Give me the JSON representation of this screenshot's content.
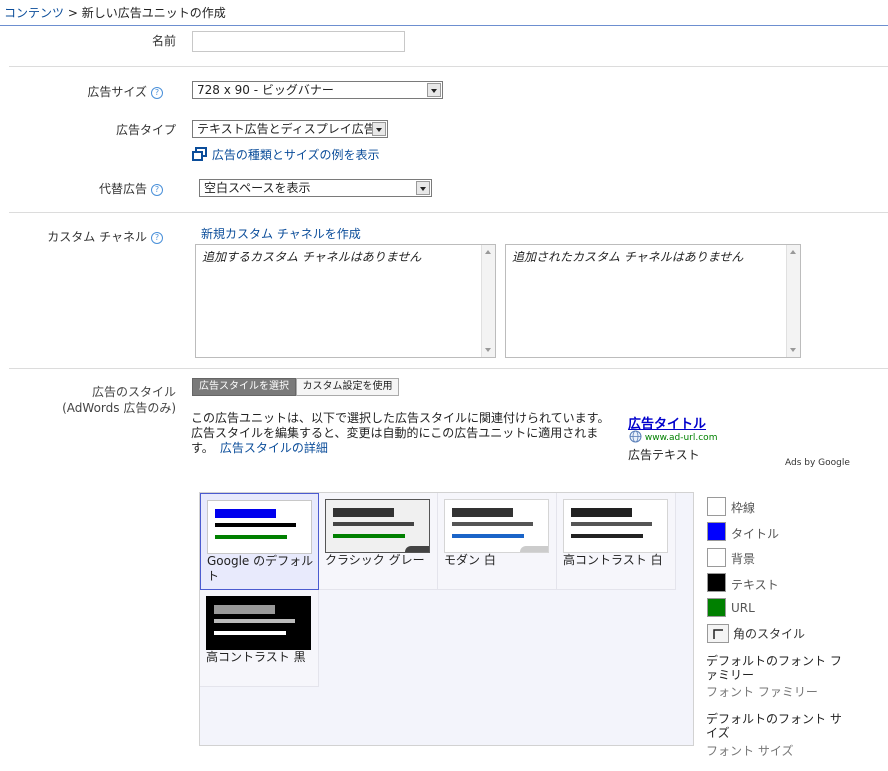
{
  "breadcrumb": {
    "root": "コンテンツ",
    "sep": " > ",
    "current": "新しい広告ユニットの作成"
  },
  "form": {
    "name_label": "名前",
    "name_value": "",
    "size_label": "広告サイズ",
    "size_value": "728 x 90 - ビッグバナー",
    "type_label": "広告タイプ",
    "type_value": "テキスト広告とディスプレイ広告",
    "type_examples_link": "広告の種類とサイズの例を表示",
    "alt_label": "代替広告",
    "alt_value": "空白スペースを表示",
    "help_glyph": "?"
  },
  "channels": {
    "label": "カスタム チャネル",
    "new_link": "新規カスタム チャネルを作成",
    "available_empty": "追加するカスタム チャネルはありません",
    "added_empty": "追加されたカスタム チャネルはありません"
  },
  "style": {
    "label": "広告のスタイル",
    "sublabel": "(AdWords 広告のみ)",
    "tab_select": "広告スタイルを選択",
    "tab_custom": "カスタム設定を使用",
    "desc_1": "この広告ユニットは、以下で選択した広告スタイルに関連付けられています。",
    "desc_2": "広告スタイルを編集すると、変更は自動的にこの広告ユニットに適用されま",
    "desc_3": "す。",
    "desc_link": "広告スタイルの詳細",
    "preview_title": "広告タイトル",
    "preview_url": "www.ad-url.com",
    "preview_text": "広告テキスト",
    "ads_by": "Ads by Google",
    "presets": [
      {
        "name": "Google のデフォルト"
      },
      {
        "name": "クラシック グレー"
      },
      {
        "name": "モダン 白"
      },
      {
        "name": "高コントラスト 白"
      },
      {
        "name": "高コントラスト 黒"
      }
    ],
    "colors": {
      "border_label": "枠線",
      "border": "#ffffff",
      "title_label": "タイトル",
      "title": "#0000ff",
      "bg_label": "背景",
      "bg": "#ffffff",
      "text_label": "テキスト",
      "text": "#000000",
      "url_label": "URL",
      "url": "#008000"
    },
    "corner_label": "角のスタイル",
    "font_family_label": "デフォルトのフォント フ",
    "font_family_label2": "ァミリー",
    "font_family_sub": "フォント ファミリー",
    "font_size_label": "デフォルトのフォント サ",
    "font_size_label2": "イズ",
    "font_size_sub": "フォント サイズ"
  }
}
